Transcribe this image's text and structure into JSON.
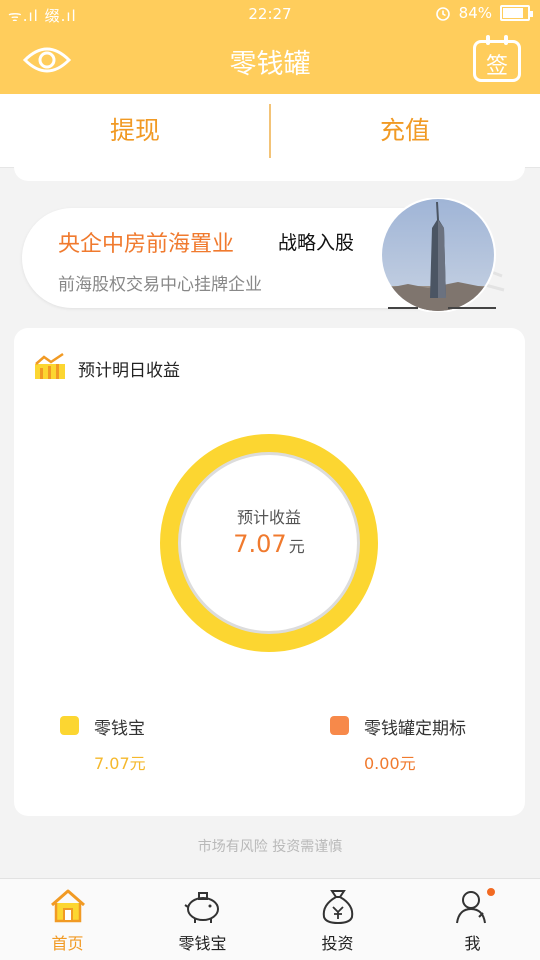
{
  "status_bar": {
    "time": "22:27",
    "battery": "84%",
    "carrier": "ᯤ.ıl 缀.ıl"
  },
  "header": {
    "title": "零钱罐",
    "sign_label": "签"
  },
  "actions": {
    "withdraw": "提现",
    "recharge": "充值"
  },
  "banner": {
    "headline": "央企中房前海置业",
    "tag": "战略入股",
    "sub": "前海股权交易中心挂牌企业"
  },
  "earnings": {
    "title": "预计明日收益",
    "center_label": "预计收益",
    "center_value": "7.07",
    "center_unit": "元",
    "items": [
      {
        "name": "零钱宝",
        "value": "7.07元",
        "color": "#fcd631",
        "fraction": 1.0
      },
      {
        "name": "零钱罐定期标",
        "value": "0.00元",
        "color": "#f7894a",
        "fraction": 0.0
      }
    ]
  },
  "risk_note": "市场有风险 投资需谨慎",
  "nav": {
    "home": "首页",
    "lingqianbao": "零钱宝",
    "invest": "投资",
    "me": "我"
  },
  "colors": {
    "accent": "#ffcd5c",
    "orange": "#f19a24",
    "donut_track": "#dcdcdc"
  }
}
